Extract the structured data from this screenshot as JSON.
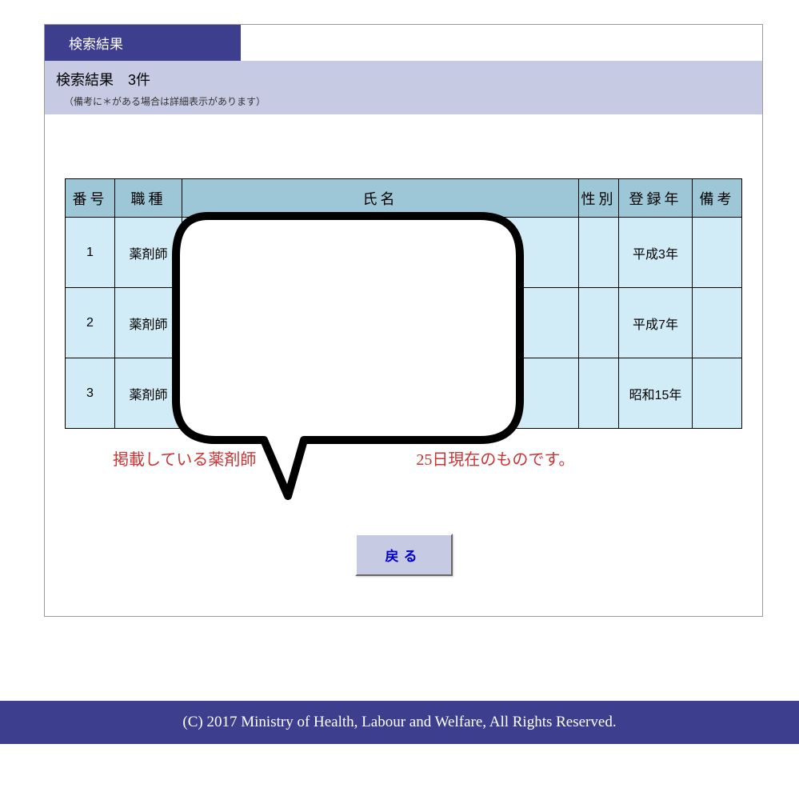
{
  "tab": {
    "label": "検索結果"
  },
  "subheader": {
    "title": "検索結果　3件",
    "note": "（備考に＊がある場合は詳細表示があります）"
  },
  "table": {
    "headers": {
      "num": "番号",
      "type": "職種",
      "name": "氏名",
      "sex": "性別",
      "year": "登録年",
      "remark": "備考"
    },
    "rows": [
      {
        "num": "1",
        "type": "薬剤師",
        "name": "",
        "sex": "",
        "year": "平成3年",
        "remark": ""
      },
      {
        "num": "2",
        "type": "薬剤師",
        "name": "",
        "sex": "",
        "year": "平成7年",
        "remark": ""
      },
      {
        "num": "3",
        "type": "薬剤師",
        "name": "",
        "sex": "",
        "year": "昭和15年",
        "remark": ""
      }
    ]
  },
  "notice": "掲載している薬剤師　　　　　　　　　　25日現在のものです。",
  "back_button": "戻る",
  "footer": "(C) 2017 Ministry of Health, Labour and Welfare, All Rights Reserved."
}
